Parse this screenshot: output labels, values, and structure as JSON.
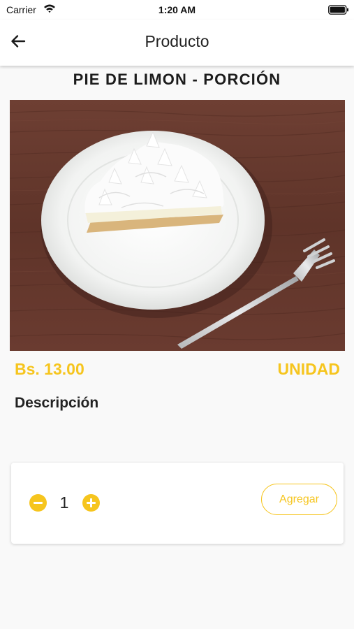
{
  "status_bar": {
    "carrier": "Carrier",
    "time": "1:20 AM"
  },
  "app_bar": {
    "title": "Producto",
    "back_icon": "arrow-left-icon"
  },
  "product": {
    "name": "PIE DE LIMON - PORCIÓN",
    "price": "Bs. 13.00",
    "unit": "UNIDAD",
    "description_heading": "Descripción"
  },
  "cart": {
    "quantity": "1",
    "add_label": "Agregar",
    "minus_icon": "minus-circle-icon",
    "plus_icon": "plus-circle-icon"
  },
  "colors": {
    "accent": "#f6c51e",
    "background": "#f9f9f9",
    "card": "#ffffff",
    "text": "#222222"
  }
}
